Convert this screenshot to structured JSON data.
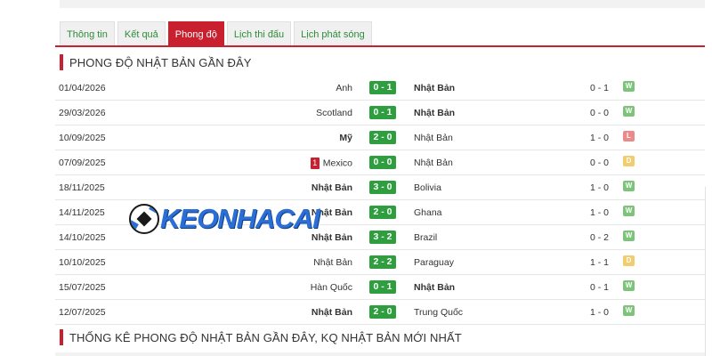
{
  "tabs": [
    {
      "label": "Thông tin",
      "active": false
    },
    {
      "label": "Kết quả",
      "active": false
    },
    {
      "label": "Phong độ",
      "active": true
    },
    {
      "label": "Lịch thi đấu",
      "active": false
    },
    {
      "label": "Lịch phát sóng",
      "active": false
    }
  ],
  "section1": {
    "title": "PHONG ĐỘ NHẬT BẢN GẦN ĐÂY"
  },
  "section2": {
    "title": "THỐNG KÊ PHONG ĐỘ NHẬT BẢN GẦN ĐÂY, KQ NHẬT BẢN MỚI NHẤT"
  },
  "watermark": {
    "text": "KEONHACAI"
  },
  "matches": [
    {
      "date": "01/04/2026",
      "home": "Anh",
      "score": "0 - 1",
      "away": "Nhật Bản",
      "ht": "0 - 1",
      "result": "W",
      "bold": "away",
      "red_cards": ""
    },
    {
      "date": "29/03/2026",
      "home": "Scotland",
      "score": "0 - 1",
      "away": "Nhật Bản",
      "ht": "0 - 0",
      "result": "W",
      "bold": "away",
      "red_cards": ""
    },
    {
      "date": "10/09/2025",
      "home": "Mỹ",
      "score": "2 - 0",
      "away": "Nhật Bản",
      "ht": "1 - 0",
      "result": "L",
      "bold": "home",
      "red_cards": ""
    },
    {
      "date": "07/09/2025",
      "home": "Mexico",
      "score": "0 - 0",
      "away": "Nhật Bản",
      "ht": "0 - 0",
      "result": "D",
      "bold": "",
      "red_cards": "1"
    },
    {
      "date": "18/11/2025",
      "home": "Nhật Bản",
      "score": "3 - 0",
      "away": "Bolivia",
      "ht": "1 - 0",
      "result": "W",
      "bold": "home",
      "red_cards": ""
    },
    {
      "date": "14/11/2025",
      "home": "Nhật Bản",
      "score": "2 - 0",
      "away": "Ghana",
      "ht": "1 - 0",
      "result": "W",
      "bold": "home",
      "red_cards": ""
    },
    {
      "date": "14/10/2025",
      "home": "Nhật Bản",
      "score": "3 - 2",
      "away": "Brazil",
      "ht": "0 - 2",
      "result": "W",
      "bold": "home",
      "red_cards": ""
    },
    {
      "date": "10/10/2025",
      "home": "Nhật Bản",
      "score": "2 - 2",
      "away": "Paraguay",
      "ht": "1 - 1",
      "result": "D",
      "bold": "",
      "red_cards": ""
    },
    {
      "date": "15/07/2025",
      "home": "Hàn Quốc",
      "score": "0 - 1",
      "away": "Nhật Bản",
      "ht": "0 - 1",
      "result": "W",
      "bold": "away",
      "red_cards": ""
    },
    {
      "date": "12/07/2025",
      "home": "Nhật Bản",
      "score": "2 - 0",
      "away": "Trung Quốc",
      "ht": "1 - 0",
      "result": "W",
      "bold": "home",
      "red_cards": ""
    }
  ],
  "colors": {
    "accent": "#c8202f",
    "score_bg": "#2e9e3e",
    "win": "#7cc47a",
    "loss": "#ea8a8a",
    "draw": "#f2cc6d",
    "tab_text": "#2e8b3a"
  }
}
